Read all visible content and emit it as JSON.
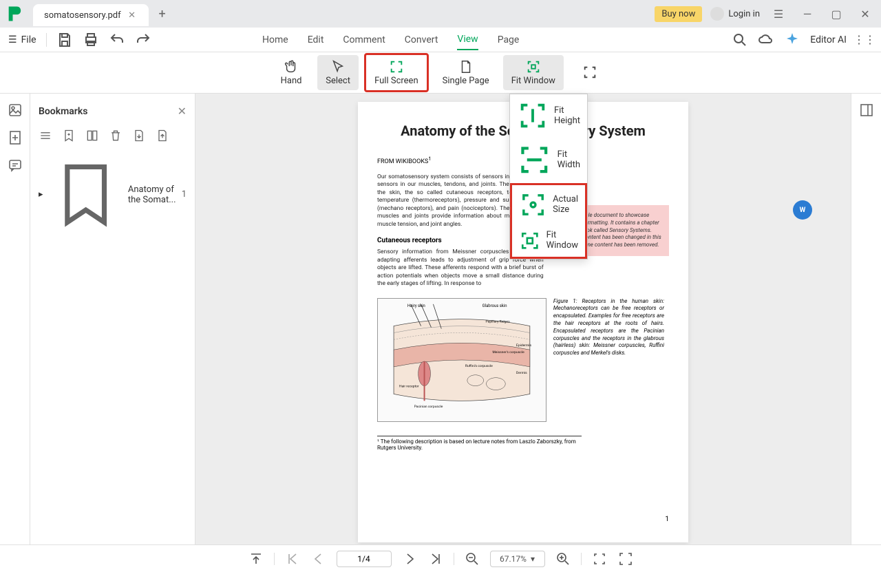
{
  "titlebar": {
    "tab_name": "somatosensory.pdf",
    "buy_now": "Buy now",
    "login": "Login in"
  },
  "toolbar": {
    "file": "File"
  },
  "menubar": {
    "items": [
      "Home",
      "Edit",
      "Comment",
      "Convert",
      "View",
      "Page"
    ],
    "editor_ai": "Editor AI"
  },
  "ribbon": {
    "hand": "Hand",
    "select": "Select",
    "full_screen": "Full Screen",
    "single_page": "Single Page",
    "fit_window": "Fit Window"
  },
  "dropdown": {
    "fit_height": "Fit Height",
    "fit_width": "Fit Width",
    "actual_size": "Actual Size",
    "fit_window": "Fit Window"
  },
  "bookmarks": {
    "title": "Bookmarks",
    "item": "Anatomy of the Somat...",
    "page": "1"
  },
  "document": {
    "title": "Anatomy of the Somatosensory System",
    "from": "FROM WIKIBOOKS",
    "p1": "Our somatosensory system consists of sensors in the skin and sensors in our muscles, tendons, and joints. The receptors in the skin, the so called cutaneous receptors, tell us about temperature (thermoreceptors), pressure and surface texture (mechano receptors), and pain (nociceptors). The receptors in muscles and joints provide information about muscle length, muscle tension, and joint angles.",
    "box": "This is a sample document to showcase page-based formatting. It contains a chapter from a Wikibook called Sensory Systems. None of the content has been changed in this article, but some content has been removed.",
    "h2": "Cutaneous receptors",
    "p2": "Sensory information from Meissner corpuscles and rapidly adapting afferents leads to adjustment of grip force when objects are lifted. These afferents respond with a brief burst of action potentials when objects move a small distance during the early stages of lifting. In response to",
    "fig_caption": "Figure 1:  Receptors in the human skin: Mechanoreceptors can be free receptors or encapsulated. Examples for free receptors are the hair receptors at the roots of hairs. Encapsulated receptors are the Pacinian corpuscles and the receptors in the glabrous (hairless) skin: Meissner corpuscles, Ruffini corpuscles and Merkel's disks.",
    "footnote": "¹ The following description is based on lecture notes from Laszlo Zaborszky, from Rutgers University.",
    "page_num": "1"
  },
  "statusbar": {
    "page": "1/4",
    "zoom": "67.17%"
  }
}
